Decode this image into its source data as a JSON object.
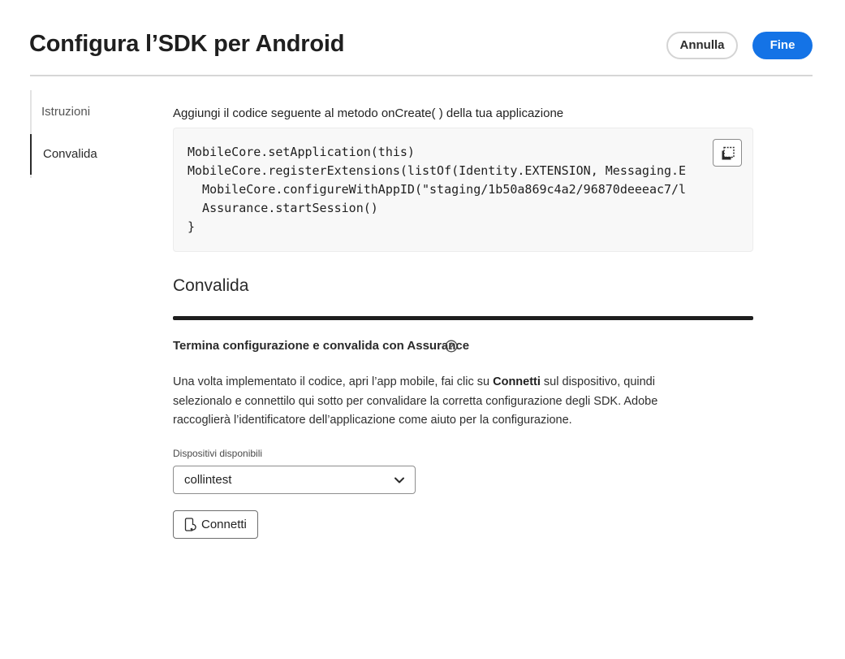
{
  "header": {
    "title": "Configura l’SDK per Android",
    "cancel_label": "Annulla",
    "done_label": "Fine",
    "accent_color": "#1473e6"
  },
  "side_nav": {
    "items": [
      {
        "label": "Istruzioni",
        "selected": false
      },
      {
        "label": "Convalida",
        "selected": true
      }
    ]
  },
  "main": {
    "instruction": "Aggiungi il codice seguente al metodo onCreate( ) della tua applicazione",
    "code_lines": [
      "MobileCore.setApplication(this)",
      "MobileCore.registerExtensions(listOf(Identity.EXTENSION, Messaging.E",
      "  MobileCore.configureWithAppID(\"staging/1b50a869c4a2/96870deeeac7/l",
      "  Assurance.startSession()",
      "}"
    ],
    "copy_icon": "copy-icon",
    "section_title": "Convalida",
    "subheading": "Termina configurazione e convalida con Assurance",
    "help_icon": "help-circle-icon",
    "paragraph": {
      "before": "Una volta implementato il codice, apri l’app mobile, fai clic su ",
      "bold": "Connetti",
      "after": " sul dispositivo, quindi selezionalo e connettilo qui sotto per convalidare la corretta configurazione degli SDK. Adobe raccoglierà l’identificatore dell’applicazione come aiuto per la configurazione."
    },
    "devices_label": "Dispositivi disponibili",
    "device_selected": "collintest",
    "connect_label": "Connetti",
    "connect_icon": "device-connect-icon"
  }
}
